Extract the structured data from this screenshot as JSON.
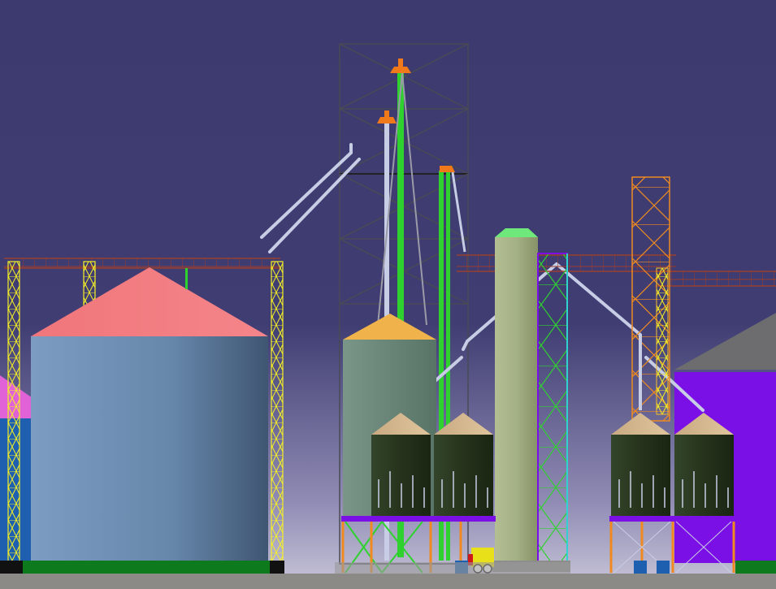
{
  "scene": {
    "colors": {
      "sky_top": "#3c3a6e",
      "sky_bottom": "#c9c6d9",
      "ground": "#8b8a86",
      "large_bin_wall": "#6f8fb3",
      "large_bin_roof": "#f0767a",
      "hopper_body": "#26331c",
      "hopper_cone": "#d2b48c",
      "tall_silo": "#a9b58a",
      "tall_silo_cap": "#6ee87a",
      "grey_bin": "#6f8c80",
      "grey_bin_roof": "#f0b24a",
      "purple_building": "#7a10e6",
      "grey_roof": "#6d6d70",
      "yellow_tower": "#f5f025",
      "leg_tube": "#2fd12f",
      "spout": "#c8cde6",
      "catwalk": "#9a3e2e",
      "support_orange": "#f08a20",
      "base_green": "#0e7a1e",
      "truck": "#e8e019"
    },
    "parts": {
      "left_bin_roof_icon": "cone-roof",
      "hopper_count": 4,
      "bucket_elevator_heads": 3
    }
  }
}
